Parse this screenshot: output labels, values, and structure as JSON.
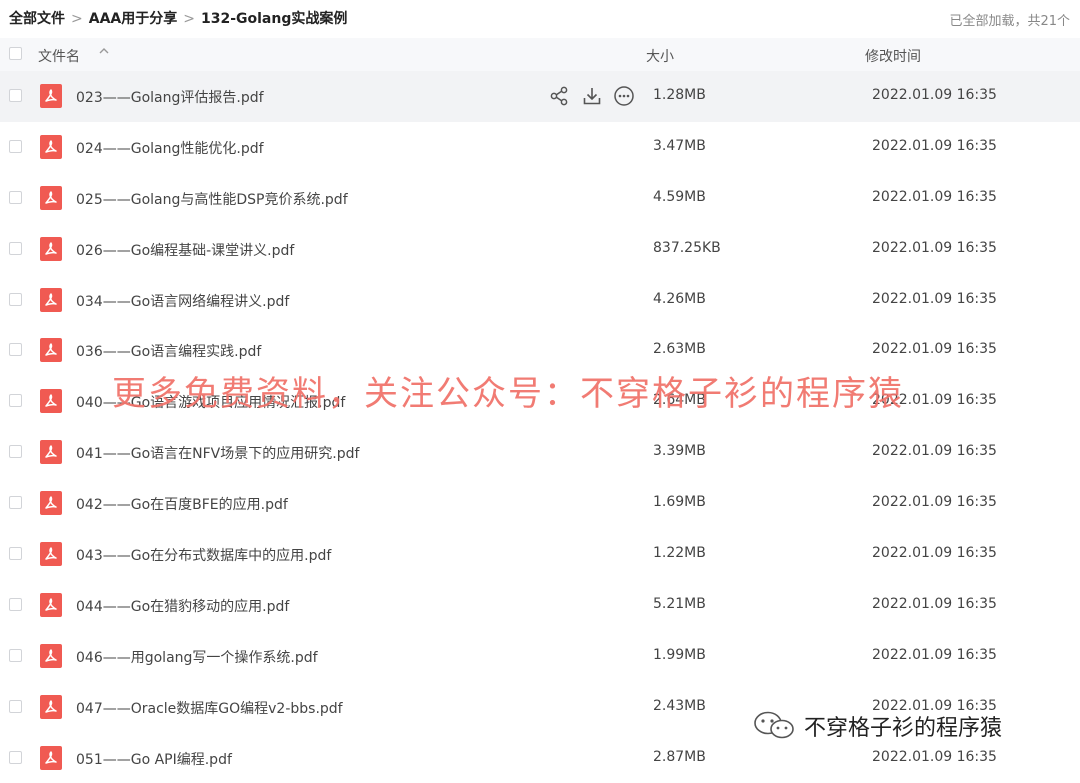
{
  "breadcrumb": [
    "全部文件",
    "AAA用于分享",
    "132-Golang实战案例"
  ],
  "load_status": "已全部加载，共21个",
  "header": {
    "name": "文件名",
    "size": "大小",
    "modified": "修改时间"
  },
  "files": [
    {
      "name": "023——Golang评估报告.pdf",
      "size": "1.28MB",
      "time": "2022.01.09 16:35"
    },
    {
      "name": "024——Golang性能优化.pdf",
      "size": "3.47MB",
      "time": "2022.01.09 16:35"
    },
    {
      "name": "025——Golang与高性能DSP竞价系统.pdf",
      "size": "4.59MB",
      "time": "2022.01.09 16:35"
    },
    {
      "name": "026——Go编程基础-课堂讲义.pdf",
      "size": "837.25KB",
      "time": "2022.01.09 16:35"
    },
    {
      "name": "034——Go语言网络编程讲义.pdf",
      "size": "4.26MB",
      "time": "2022.01.09 16:35"
    },
    {
      "name": "036——Go语言编程实践.pdf",
      "size": "2.63MB",
      "time": "2022.01.09 16:35"
    },
    {
      "name": "040——Go语言游戏项目应用情况汇报.pdf",
      "size": "2.64MB",
      "time": "2022.01.09 16:35"
    },
    {
      "name": "041——Go语言在NFV场景下的应用研究.pdf",
      "size": "3.39MB",
      "time": "2022.01.09 16:35"
    },
    {
      "name": "042——Go在百度BFE的应用.pdf",
      "size": "1.69MB",
      "time": "2022.01.09 16:35"
    },
    {
      "name": "043——Go在分布式数据库中的应用.pdf",
      "size": "1.22MB",
      "time": "2022.01.09 16:35"
    },
    {
      "name": "044——Go在猎豹移动的应用.pdf",
      "size": "5.21MB",
      "time": "2022.01.09 16:35"
    },
    {
      "name": "046——用golang写一个操作系统.pdf",
      "size": "1.99MB",
      "time": "2022.01.09 16:35"
    },
    {
      "name": "047——Oracle数据库GO编程v2-bbs.pdf",
      "size": "2.43MB",
      "time": "2022.01.09 16:35"
    },
    {
      "name": "051——Go API编程.pdf",
      "size": "2.87MB",
      "time": "2022.01.09 16:35"
    }
  ],
  "watermark": "更多免费资料，关注公众号：不穿格子衫的程序猿",
  "brand": "不穿格子衫的程序猿",
  "colors": {
    "accent_pdf": "#f05a52",
    "watermark": "#f07068",
    "header_bg": "#f7f8fa"
  }
}
